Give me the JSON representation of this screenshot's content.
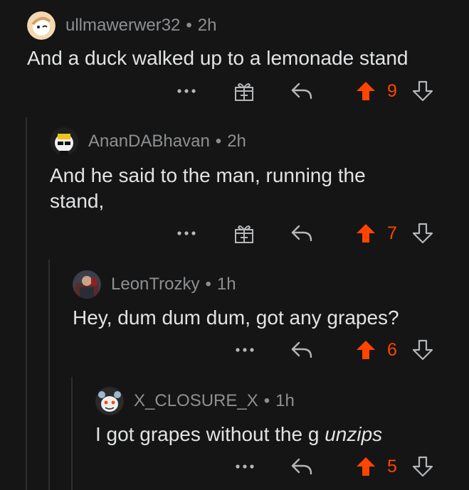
{
  "comments": [
    {
      "username": "ullmawerwer32",
      "age": "2h",
      "body": "And a duck walked up to a lemonade stand",
      "body_italic": "",
      "score": "9",
      "has_award": true
    },
    {
      "username": "AnanDABhavan",
      "age": "2h",
      "body": "And he said to the man, running the stand,",
      "body_italic": "",
      "score": "7",
      "has_award": true
    },
    {
      "username": "LeonTrozky",
      "age": "1h",
      "body": "Hey, dum dum dum, got any grapes?",
      "body_italic": "",
      "score": "6",
      "has_award": false
    },
    {
      "username": "X_CLOSURE_X",
      "age": "1h",
      "body": "I got grapes without the g ",
      "body_italic": "unzips",
      "score": "5",
      "has_award": false
    }
  ],
  "meta_separator": "•",
  "more_label": "•••",
  "icons": {
    "more": "more-icon",
    "award": "award-icon",
    "reply": "reply-icon",
    "upvote": "upvote-icon",
    "downvote": "downvote-icon"
  },
  "colors": {
    "background": "#151515",
    "text": "#e1e3e5",
    "meta": "#8d9093",
    "icon": "#b5b8bb",
    "upvote": "#ff4500",
    "thread_line": "#2e2e2e"
  }
}
